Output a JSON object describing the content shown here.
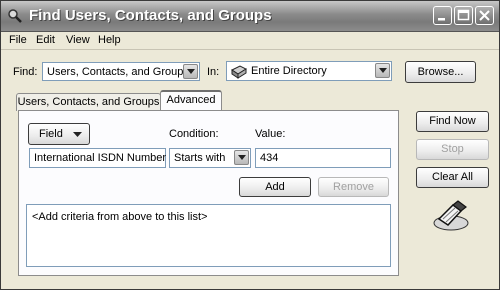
{
  "window": {
    "title": "Find Users, Contacts, and Groups"
  },
  "menu": {
    "items": [
      "File",
      "Edit",
      "View",
      "Help"
    ]
  },
  "find_row": {
    "find_label": "Find:",
    "find_value": "Users, Contacts, and Groups",
    "in_label": "In:",
    "in_value": "Entire Directory",
    "browse_label": "Browse..."
  },
  "tabs": [
    {
      "label": "Users, Contacts, and Groups",
      "active": false
    },
    {
      "label": "Advanced",
      "active": true
    }
  ],
  "criteria": {
    "field_button": "Field",
    "condition_label": "Condition:",
    "value_label": "Value:",
    "field_value": "International ISDN Number",
    "condition_value": "Starts with",
    "value_value": "434",
    "add_button": "Add",
    "remove_button": "Remove",
    "list_placeholder": "<Add criteria from above to this list>"
  },
  "actions": {
    "find_now": "Find Now",
    "stop": "Stop",
    "clear_all": "Clear All"
  },
  "icons": {
    "app": "find-people-icon",
    "search_graphic": "flashlight-search-icon"
  }
}
